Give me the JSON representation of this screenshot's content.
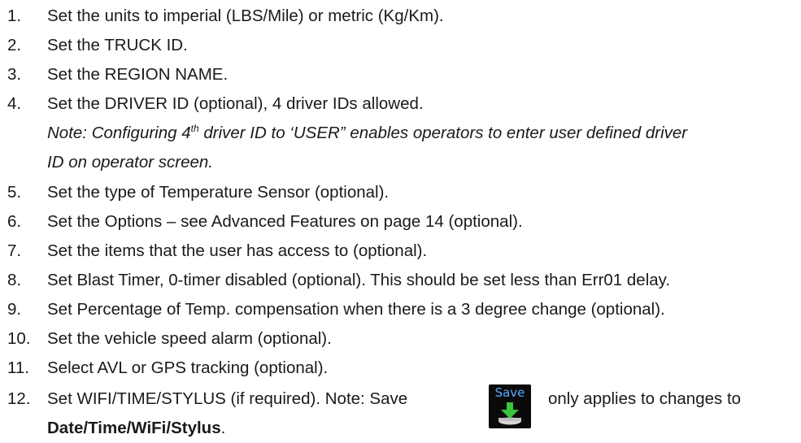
{
  "items": [
    {
      "num": "1.",
      "text": "Set the units to imperial (LBS/Mile) or metric (Kg/Km)."
    },
    {
      "num": "2.",
      "text": "Set the TRUCK ID."
    },
    {
      "num": "3.",
      "text": "Set the REGION NAME."
    },
    {
      "num": "4.",
      "text": "Set the DRIVER ID (optional), 4 driver IDs allowed."
    },
    {
      "num": "5.",
      "text": "Set the type of Temperature Sensor (optional)."
    },
    {
      "num": "6.",
      "text": "Set the Options – see Advanced Features on page 14 (optional)."
    },
    {
      "num": "7.",
      "text": "Set the items that the user has access to (optional)."
    },
    {
      "num": "8.",
      "text": "Set Blast Timer, 0-timer disabled (optional). This should be set less than Err01 delay."
    },
    {
      "num": "9.",
      "text": "Set Percentage of Temp. compensation when there is a 3 degree change (optional)."
    },
    {
      "num": "10.",
      "text": "Set the vehicle speed alarm (optional)."
    },
    {
      "num": "11.",
      "text": "Select AVL or GPS tracking (optional)."
    },
    {
      "num": "12.",
      "text": "Set WIFI/TIME/STYLUS (if required). Note: Save"
    }
  ],
  "note": {
    "prefix": "Note: Configuring 4",
    "superscript": "th",
    "suffix": " driver ID to ‘USER” enables operators to enter user defined driver",
    "line2": "ID on operator screen."
  },
  "save_icon": {
    "label": "Save",
    "icon": "save-download-icon",
    "bg_color": "#0a0a0a",
    "label_color": "#5aa9ff",
    "arrow_color": "#3cc43c"
  },
  "item12_tail": "only applies to changes to",
  "item12_bold": "Date/Time/WiFi/Stylus",
  "item12_end": "."
}
